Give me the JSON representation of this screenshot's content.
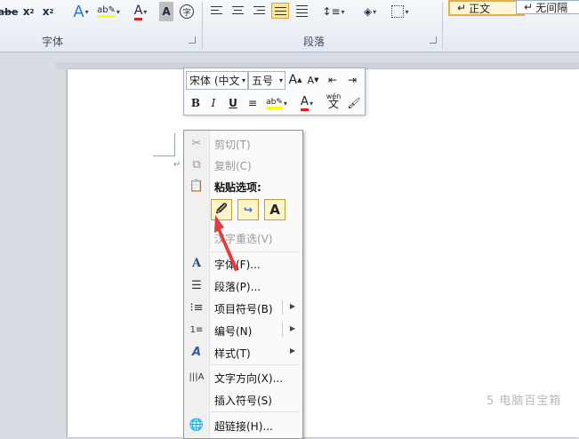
{
  "ribbon": {
    "font_group_label": "字体",
    "paragraph_group_label": "段落",
    "font_buttons": [
      "abe",
      "x",
      "x"
    ],
    "styles": [
      "正文",
      "无间隔"
    ]
  },
  "mini_toolbar": {
    "font_name": "宋体 (中文",
    "font_size": "五号",
    "bold": "B",
    "italic": "I",
    "underline": "U",
    "font_color_glyph": "A",
    "grow_glyph": "A",
    "shrink_glyph": "A",
    "phonetic_top": "wén",
    "phonetic_char": "文"
  },
  "context_menu": {
    "items": [
      {
        "label": "剪切(T)",
        "disabled": true,
        "icon": "scissors-icon"
      },
      {
        "label": "复制(C)",
        "disabled": true,
        "icon": "copy-icon"
      },
      {
        "label": "粘贴选项:",
        "disabled": false,
        "icon": "clipboard-icon",
        "bold": true
      },
      {
        "label": "汉字重选(V)",
        "disabled": true,
        "icon": ""
      },
      {
        "label": "字体(F)...",
        "disabled": false,
        "icon": "font-icon"
      },
      {
        "label": "段落(P)...",
        "disabled": false,
        "icon": "paragraph-icon"
      },
      {
        "label": "项目符号(B)",
        "disabled": false,
        "icon": "bullets-icon",
        "submenu": true
      },
      {
        "label": "编号(N)",
        "disabled": false,
        "icon": "numbering-icon",
        "submenu": true
      },
      {
        "label": "样式(T)",
        "disabled": false,
        "icon": "styles-icon",
        "submenu": true
      },
      {
        "label": "文字方向(X)...",
        "disabled": false,
        "icon": "text-direction-icon"
      },
      {
        "label": "插入符号(S)",
        "disabled": false,
        "icon": ""
      },
      {
        "label": "超链接(H)...",
        "disabled": false,
        "icon": "hyperlink-icon"
      }
    ],
    "paste_text_only_glyph": "A"
  },
  "watermark": "5 电脑百宝箱"
}
